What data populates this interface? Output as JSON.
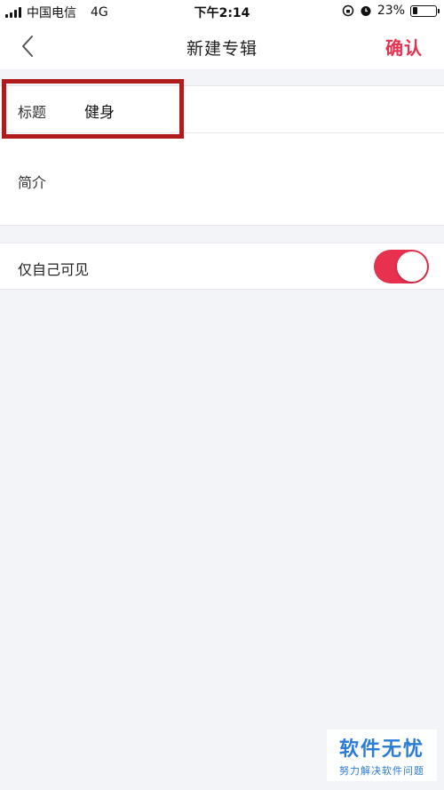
{
  "status_bar": {
    "carrier": "中国电信",
    "network": "4G",
    "time": "下午2:14",
    "battery_percent": "23%",
    "battery_level": 0.23
  },
  "navbar": {
    "title": "新建专辑",
    "confirm_label": "确认",
    "accent_color": "#e8304f"
  },
  "form": {
    "title_label": "标题",
    "title_value": "健身",
    "intro_label": "简介",
    "private_label": "仅自己可见",
    "private_enabled": true
  },
  "watermark": {
    "main": "软件无忧",
    "sub": "努力解决软件问题"
  }
}
